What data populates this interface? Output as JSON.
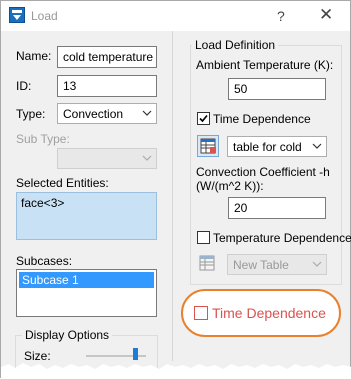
{
  "window": {
    "title": "Load",
    "help_label": "?",
    "close_label": "✕"
  },
  "left": {
    "name_label": "Name:",
    "name_value": "cold temperature",
    "id_label": "ID:",
    "id_value": "13",
    "type_label": "Type:",
    "type_value": "Convection",
    "subtype_label": "Sub Type:",
    "subtype_value": "",
    "selected_entities_label": "Selected Entities:",
    "selected_entities": [
      "face<3>"
    ],
    "subcases_label": "Subcases:",
    "subcases": [
      "Subcase 1"
    ],
    "display_options_label": "Display Options",
    "size_label": "Size:",
    "size_level": 0.85
  },
  "load_definition": {
    "group_label": "Load Definition",
    "ambient_label": "Ambient Temperature (K):",
    "ambient_value": "50",
    "time_dep_label": "Time Dependence",
    "time_dep_checked": true,
    "table_value": "table for cold",
    "conv_label_line1": "Convection Coefficient -h",
    "conv_label_line2": "(W/(m^2 K)):",
    "conv_value": "20",
    "temp_dep_label": "Temperature Dependence",
    "temp_dep_checked": false,
    "new_table_value": "New Table"
  },
  "callout": {
    "label": "Time Dependence",
    "checked": false,
    "color": "#e8812e"
  },
  "colors": {
    "selection": "#c8e1f5",
    "subcase_highlight": "#3399ff",
    "accent_red": "#d9534f"
  }
}
